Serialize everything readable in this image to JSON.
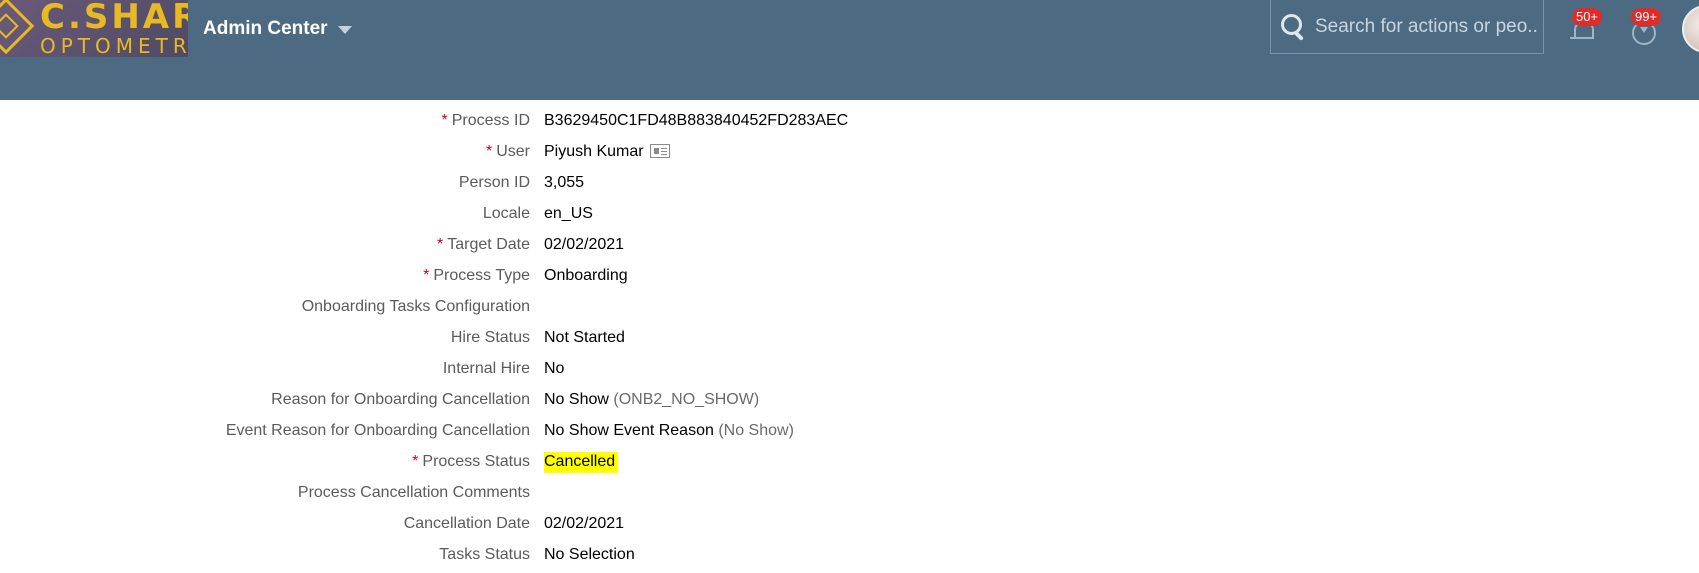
{
  "header": {
    "logo_text_line1": "C.SHAR",
    "logo_text_line2": "OPTOMETR",
    "app_title": "Admin Center",
    "search": {
      "placeholder": "Search for actions or peo..."
    },
    "notifications_badge": "50+",
    "approvals_badge": "99+"
  },
  "fields": [
    {
      "label": "Process ID",
      "required": true,
      "value": "B3629450C1FD48B883840452FD283AEC"
    },
    {
      "label": "User",
      "required": true,
      "value": "Piyush Kumar"
    },
    {
      "label": "Person ID",
      "required": false,
      "value": "3,055"
    },
    {
      "label": "Locale",
      "required": false,
      "value": "en_US"
    },
    {
      "label": "Target Date",
      "required": true,
      "value": "02/02/2021"
    },
    {
      "label": "Process Type",
      "required": true,
      "value": "Onboarding"
    },
    {
      "label": "Onboarding Tasks Configuration",
      "required": false,
      "value": ""
    },
    {
      "label": "Hire Status",
      "required": false,
      "value": "Not Started"
    },
    {
      "label": "Internal Hire",
      "required": false,
      "value": "No"
    },
    {
      "label": "Reason for Onboarding Cancellation",
      "required": false,
      "value": "No Show",
      "code": "(ONB2_NO_SHOW)"
    },
    {
      "label": "Event Reason for Onboarding Cancellation",
      "required": false,
      "value": "No Show Event Reason",
      "code": "(No Show)"
    },
    {
      "label": "Process Status",
      "required": true,
      "value": "Cancelled"
    },
    {
      "label": "Process Cancellation Comments",
      "required": false,
      "value": ""
    },
    {
      "label": "Cancellation Date",
      "required": false,
      "value": "02/02/2021"
    },
    {
      "label": "Tasks Status",
      "required": false,
      "value": "No Selection"
    }
  ],
  "required_marker": "*",
  "colors": {
    "shellbar": "#4c6b82",
    "required": "#d0001b",
    "highlight": "#ffff00",
    "badge": "#e02b2b"
  },
  "icons": [
    "search-icon",
    "bell-icon",
    "approvals-icon",
    "user-card-icon",
    "caret-down-icon"
  ]
}
